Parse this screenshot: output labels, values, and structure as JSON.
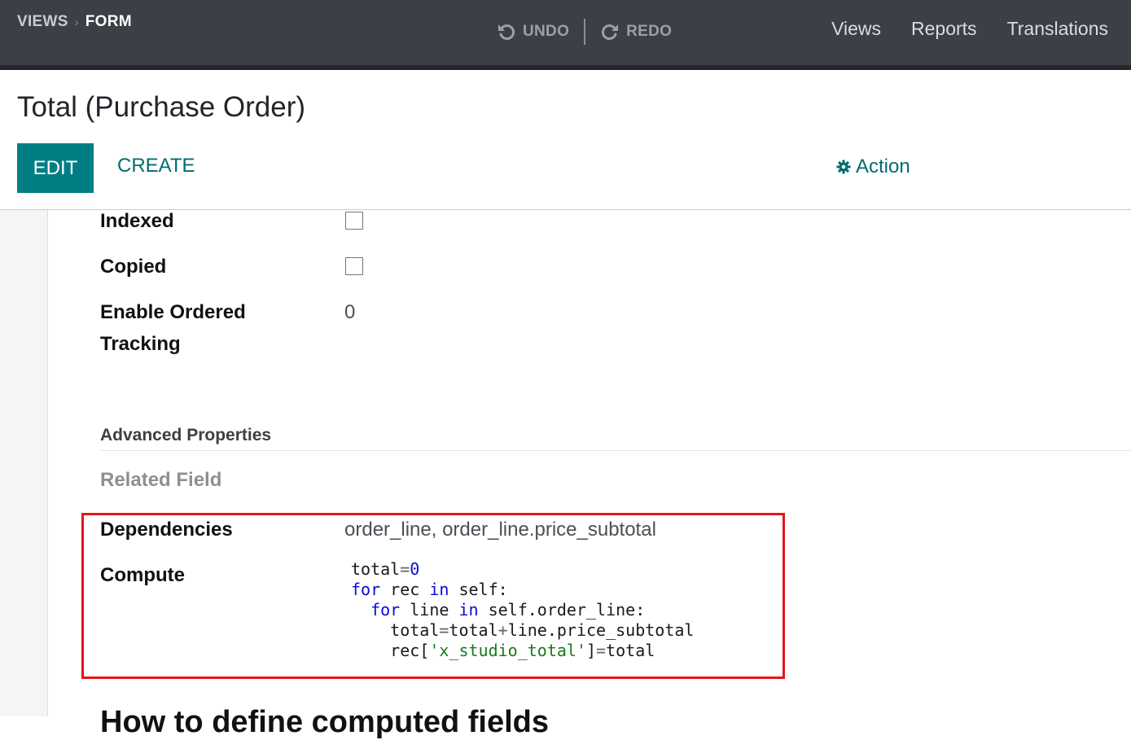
{
  "topbar": {
    "breadcrumb": [
      "VIEWS",
      "FORM"
    ],
    "undo_label": "UNDO",
    "redo_label": "REDO",
    "nav": [
      "Views",
      "Reports",
      "Translations"
    ]
  },
  "control_panel": {
    "title": "Total (Purchase Order)",
    "edit_label": "EDIT",
    "create_label": "CREATE",
    "action_label": "Action"
  },
  "form": {
    "fields": [
      {
        "label": "Indexed",
        "type": "checkbox",
        "checked": false
      },
      {
        "label": "Copied",
        "type": "checkbox",
        "checked": false
      },
      {
        "label": "Enable Ordered Tracking",
        "label_lines": [
          "Enable Ordered",
          "Tracking"
        ],
        "type": "number",
        "value": "0"
      }
    ],
    "advanced_title": "Advanced Properties",
    "related_field_label": "Related Field",
    "dependencies_label": "Dependencies",
    "dependencies_value": "order_line, order_line.price_subtotal",
    "compute_label": "Compute",
    "compute_code": [
      "total=0",
      "for rec in self:",
      "  for line in self.order_line:",
      "    total=total+line.price_subtotal",
      "    rec['x_studio_total']=total"
    ],
    "next_heading": "How to define computed fields"
  },
  "colors": {
    "topbar_bg": "#3b4046",
    "primary": "#017e84",
    "link": "#016b70",
    "highlight_border": "#e8141a",
    "code_keyword": "#0a0ad6",
    "code_string": "#177b17"
  }
}
